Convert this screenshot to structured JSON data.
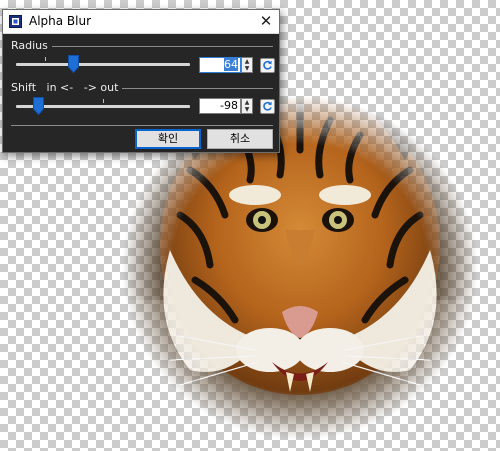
{
  "dialog": {
    "title": "Alpha Blur",
    "close_glyph": "✕",
    "icons": [
      "app-icon",
      "close-icon",
      "reset-icon",
      "spin-up-icon",
      "spin-down-icon"
    ]
  },
  "radius": {
    "label": "Radius",
    "value": "64",
    "slider_position": 0.33
  },
  "shift": {
    "label": "Shift",
    "label_in": "in <-",
    "label_out": "-> out",
    "value": "-98",
    "slider_position": 0.13
  },
  "buttons": {
    "ok_label": "확인",
    "cancel_label": "취소"
  },
  "colors": {
    "accent": "#2f7fd9",
    "dialog_bg": "#262626",
    "default_button_border": "#0a64d0"
  }
}
